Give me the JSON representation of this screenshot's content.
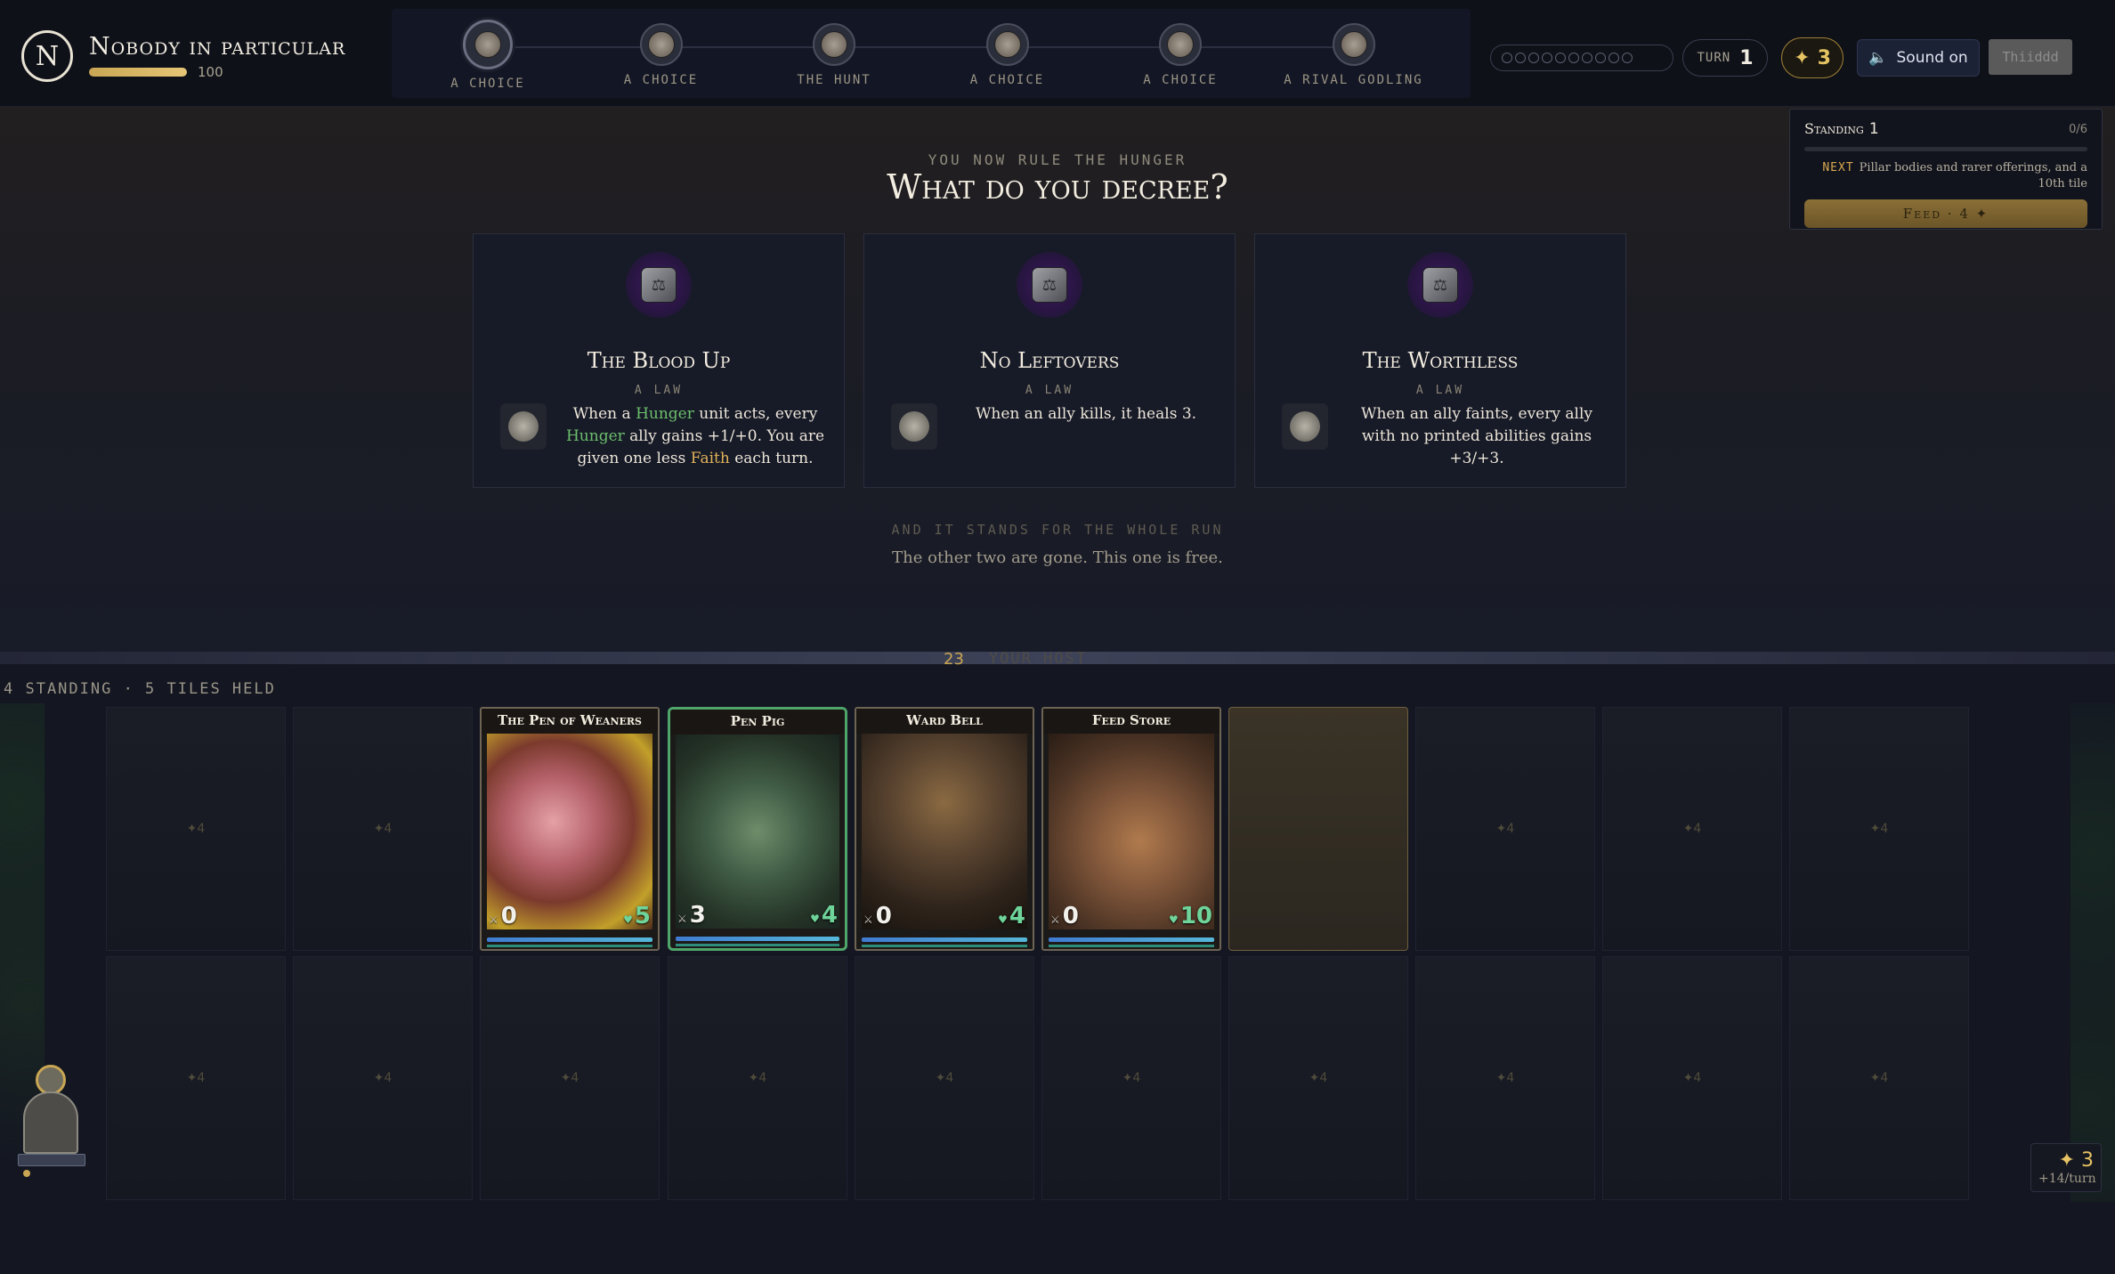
{
  "player": {
    "initial": "N",
    "name": "Nobody in particular",
    "hp": 100,
    "hp_fraction": 1.0
  },
  "path_nodes": [
    {
      "label": "A choice",
      "icon": "crossroads-icon",
      "active": true
    },
    {
      "label": "A choice",
      "icon": "crossroads-icon",
      "active": false
    },
    {
      "label": "The Hunt",
      "icon": "hunt-icon",
      "active": false
    },
    {
      "label": "A choice",
      "icon": "crossroads-icon",
      "active": false
    },
    {
      "label": "A choice",
      "icon": "crossroads-icon",
      "active": false
    },
    {
      "label": "A rival godling",
      "icon": "rival-icon",
      "active": false
    }
  ],
  "hud": {
    "coin_slots": 10,
    "turn_label": "TURN",
    "turn_value": "1",
    "faith_symbol": "✦",
    "faith_value": "3",
    "sound_label": "Sound on",
    "third_button": "Thiiddd"
  },
  "standing": {
    "title": "Standing",
    "level": "1",
    "progress": "0/6",
    "progress_fraction": 0,
    "next_label": "NEXT",
    "next_text": "Pillar bodies and rarer offerings, and a 10th tile",
    "feed_button": "Feed · 4 ✦"
  },
  "decree": {
    "eyebrow": "You now rule the Hunger",
    "title": "What do you decree?",
    "footer_eyebrow": "And it stands for the whole run",
    "footer_text": "The other two are gone. This one is free."
  },
  "laws": [
    {
      "title": "The Blood Up",
      "type": "A law",
      "segments": [
        {
          "text": "When a ",
          "style": "plain"
        },
        {
          "text": "Hunger",
          "style": "green"
        },
        {
          "text": " unit acts, every ",
          "style": "plain"
        },
        {
          "text": "Hunger",
          "style": "green"
        },
        {
          "text": " ally gains +1/+0. You are given one less ",
          "style": "plain"
        },
        {
          "text": "Faith",
          "style": "gold"
        },
        {
          "text": " each turn.",
          "style": "plain"
        }
      ]
    },
    {
      "title": "No Leftovers",
      "type": "A law",
      "segments": [
        {
          "text": "When an ally kills, it heals 3.",
          "style": "plain"
        }
      ]
    },
    {
      "title": "The Worthless",
      "type": "A law",
      "segments": [
        {
          "text": "When an ally faints, every ally with no printed abilities gains +3/+3.",
          "style": "plain"
        }
      ]
    }
  ],
  "host": {
    "count": "23",
    "label": "Your host"
  },
  "board": {
    "status": "4 standing · 5 tiles held",
    "empty_tile_label": "✦4",
    "cards": [
      {
        "name": "The Pen of Weaners",
        "attack": "0",
        "health": "5",
        "selected": false,
        "art": "pig-feast-art"
      },
      {
        "name": "Pen Pig",
        "attack": "3",
        "health": "4",
        "selected": true,
        "art": "boar-art"
      },
      {
        "name": "Ward Bell",
        "attack": "0",
        "health": "4",
        "selected": false,
        "art": "bell-art"
      },
      {
        "name": "Feed Store",
        "attack": "0",
        "health": "10",
        "selected": false,
        "art": "hog-art"
      }
    ]
  },
  "income": {
    "value": "✦ 3",
    "rate": "+14/turn"
  }
}
